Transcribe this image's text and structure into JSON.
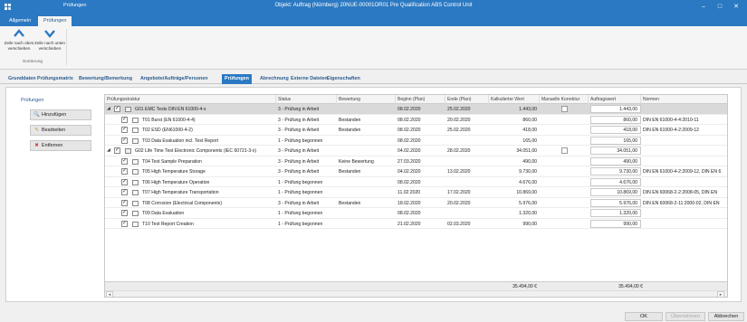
{
  "window": {
    "app_tab": "Prüfungen",
    "title": "Objekt: Auftrag (Nürnberg) 20NUE-00001OR01 Pre Qualification ABS Control Unit",
    "minimize": "–",
    "maximize": "□",
    "close": "✕"
  },
  "ribbon": {
    "tabs": [
      "Allgemein",
      "Prüfungen"
    ],
    "buttons": [
      {
        "label": "Zeile nach oben verschieben",
        "icon": "chevron-up-icon"
      },
      {
        "label": "Zeile nach unten verschieben",
        "icon": "chevron-down-icon"
      }
    ],
    "group_label": "Sortierung"
  },
  "main_tabs": [
    "Grunddaten",
    "Prüfungsmatrix",
    "Bewertung/Bemerkung",
    "Angebote/Aufträge/Personen",
    "Prüfungen",
    "Abrechnung",
    "Externe Dateien",
    "Eigenschaften"
  ],
  "active_main_tab": "Prüfungen",
  "sidebar": {
    "title": "Prüfungen",
    "buttons": [
      {
        "label": "Hinzufügen",
        "icon": "search-icon",
        "glyph": "🔍"
      },
      {
        "label": "Bearbeiten",
        "icon": "pencil-icon",
        "glyph": "✎"
      },
      {
        "label": "Entfernen",
        "icon": "delete-icon",
        "glyph": "✖"
      }
    ]
  },
  "grid": {
    "columns": [
      "Prüfungsstruktur",
      "Status",
      "Bewertung",
      "Beginn (Plan)",
      "Ende (Plan)",
      "Kalkulierter Wert",
      "Manuelle Korrektur",
      "Auftragswert",
      "Normen"
    ],
    "rows": [
      {
        "expander": "◢",
        "level": 0,
        "checked": true,
        "name": "G01 EMC Tests DIN EN 61000-4-x",
        "status": "3 - Prüfung in Arbeit",
        "bewertung": "",
        "beginn": "08.02.2020",
        "ende": "25.02.2020",
        "kalk": "1.443,00",
        "manual": true,
        "auftrag": "1.443,00",
        "normen": "",
        "selected": true
      },
      {
        "level": 1,
        "checked": true,
        "name": "T01 Burst (EN 61000-4-4)",
        "status": "3 - Prüfung in Arbeit",
        "bewertung": "Bestanden",
        "beginn": "08.02.2020",
        "ende": "20.02.2020",
        "kalk": "860,00",
        "manual": false,
        "auftrag": "860,00",
        "normen": "DIN EN 61000-4-4:2010-11"
      },
      {
        "level": 1,
        "checked": true,
        "name": "T02 ESD (EN61000-4-2)",
        "status": "3 - Prüfung in Arbeit",
        "bewertung": "Bestanden",
        "beginn": "08.02.2020",
        "ende": "25.02.2020",
        "kalk": "418,00",
        "manual": false,
        "auftrag": "418,00",
        "normen": "DIN EN 61000-4-2:2009-12"
      },
      {
        "level": 1,
        "checked": true,
        "name": "T03 Data Evaluation incl. Test Report",
        "status": "1 - Prüfung begonnen",
        "bewertung": "",
        "beginn": "08.02.2020",
        "ende": "",
        "kalk": "165,00",
        "manual": false,
        "auftrag": "165,00",
        "normen": ""
      },
      {
        "expander": "◢",
        "level": 0,
        "checked": true,
        "name": "G02 Life Time Test Electronic Components (IEC 60721-3-x)",
        "status": "3 - Prüfung in Arbeit",
        "bewertung": "",
        "beginn": "04.02.2020",
        "ende": "28.02.2020",
        "kalk": "34.051,00",
        "manual": true,
        "auftrag": "34.051,00",
        "normen": ""
      },
      {
        "level": 1,
        "checked": true,
        "name": "T04 Test Sample Preparation",
        "status": "3 - Prüfung in Arbeit",
        "bewertung": "Keine Bewertung",
        "beginn": "27.03.2020",
        "ende": "",
        "kalk": "490,00",
        "manual": false,
        "auftrag": "490,00",
        "normen": ""
      },
      {
        "level": 1,
        "checked": true,
        "name": "T05 High Temperature Storage",
        "status": "3 - Prüfung in Arbeit",
        "bewertung": "Bestanden",
        "beginn": "04.02.2020",
        "ende": "13.02.2020",
        "kalk": "9.730,00",
        "manual": false,
        "auftrag": "9.730,00",
        "normen": "DIN EN 61000-4-2:2009-12, DIN EN 6"
      },
      {
        "level": 1,
        "checked": true,
        "name": "T06 High Temperature Operation",
        "status": "1 - Prüfung begonnen",
        "bewertung": "",
        "beginn": "08.02.2020",
        "ende": "",
        "kalk": "4.676,00",
        "manual": false,
        "auftrag": "4.676,00",
        "normen": ""
      },
      {
        "level": 1,
        "checked": true,
        "name": "T07 High Temperature Transportation",
        "status": "1 - Prüfung begonnen",
        "bewertung": "",
        "beginn": "11.02.2020",
        "ende": "17.02.2020",
        "kalk": "10.869,00",
        "manual": false,
        "auftrag": "10.869,00",
        "normen": "DIN EN 60068-2-2:2008-05, DIN EN"
      },
      {
        "level": 1,
        "checked": true,
        "name": "T08 Corrosion (Electrical Components)",
        "status": "3 - Prüfung in Arbeit",
        "bewertung": "Bestanden",
        "beginn": "18.02.2020",
        "ende": "20.02.2020",
        "kalk": "5.976,00",
        "manual": false,
        "auftrag": "5.976,00",
        "normen": "DIN EN 60068-2-11:2000-02, DIN EN"
      },
      {
        "level": 1,
        "checked": true,
        "name": "T09 Data Evaluation",
        "status": "1 - Prüfung begonnen",
        "bewertung": "",
        "beginn": "08.02.2020",
        "ende": "",
        "kalk": "1.320,00",
        "manual": false,
        "auftrag": "1.320,00",
        "normen": ""
      },
      {
        "level": 1,
        "checked": true,
        "name": "T10 Test Report Creation",
        "status": "1 - Prüfung begonnen",
        "bewertung": "",
        "beginn": "21.02.2020",
        "ende": "02.03.2020",
        "kalk": "990,00",
        "manual": false,
        "auftrag": "990,00",
        "normen": ""
      }
    ],
    "footer": {
      "kalk_total": "35.494,00 €",
      "auftrag_total": "35.494,00 €"
    },
    "scroll_left": "◂",
    "scroll_right": "▸"
  },
  "footer_buttons": {
    "ok": "OK",
    "apply": "Übernehmen",
    "cancel": "Abbrechen"
  },
  "colors": {
    "accent": "#2b79c2",
    "selected_row": "#d9d9d9"
  }
}
